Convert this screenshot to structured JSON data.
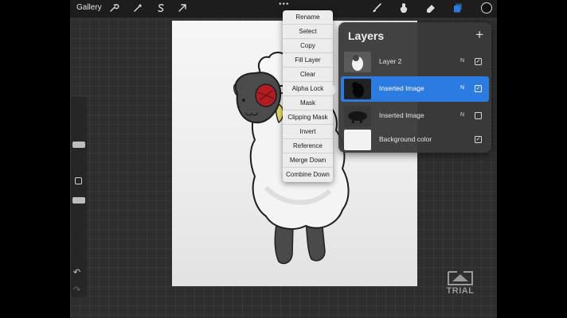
{
  "topbar": {
    "gallery_label": "Gallery",
    "tools_left": [
      "wrench-icon",
      "magic-wand-icon",
      "selection-s-icon",
      "transform-arrow-icon"
    ],
    "more_dots": "•••",
    "tools_right": [
      "brush-icon",
      "smudge-icon",
      "eraser-icon",
      "layers-icon"
    ],
    "current_color": "#111111"
  },
  "sidebar": {
    "undo_icon": "↶",
    "redo_icon": "↷"
  },
  "context_menu": {
    "items": [
      "Rename",
      "Select",
      "Copy",
      "Fill Layer",
      "Clear",
      "Alpha Lock",
      "Mask",
      "Clipping Mask",
      "Invert",
      "Reference",
      "Merge Down",
      "Combine Down"
    ]
  },
  "layers_panel": {
    "title": "Layers",
    "add_icon": "+",
    "layers": [
      {
        "name": "Layer 2",
        "mode": "N",
        "visible": true,
        "active": false
      },
      {
        "name": "Inserted Image",
        "mode": "N",
        "visible": true,
        "active": true
      },
      {
        "name": "Inserted Image",
        "mode": "N",
        "visible": false,
        "active": false
      },
      {
        "name": "Background color",
        "mode": "",
        "visible": true,
        "active": false
      }
    ]
  },
  "trial": {
    "label": "TRIAL"
  },
  "colors": {
    "accent": "#2b7be0",
    "panel": "#3a3a3a",
    "menu": "#ececec"
  }
}
